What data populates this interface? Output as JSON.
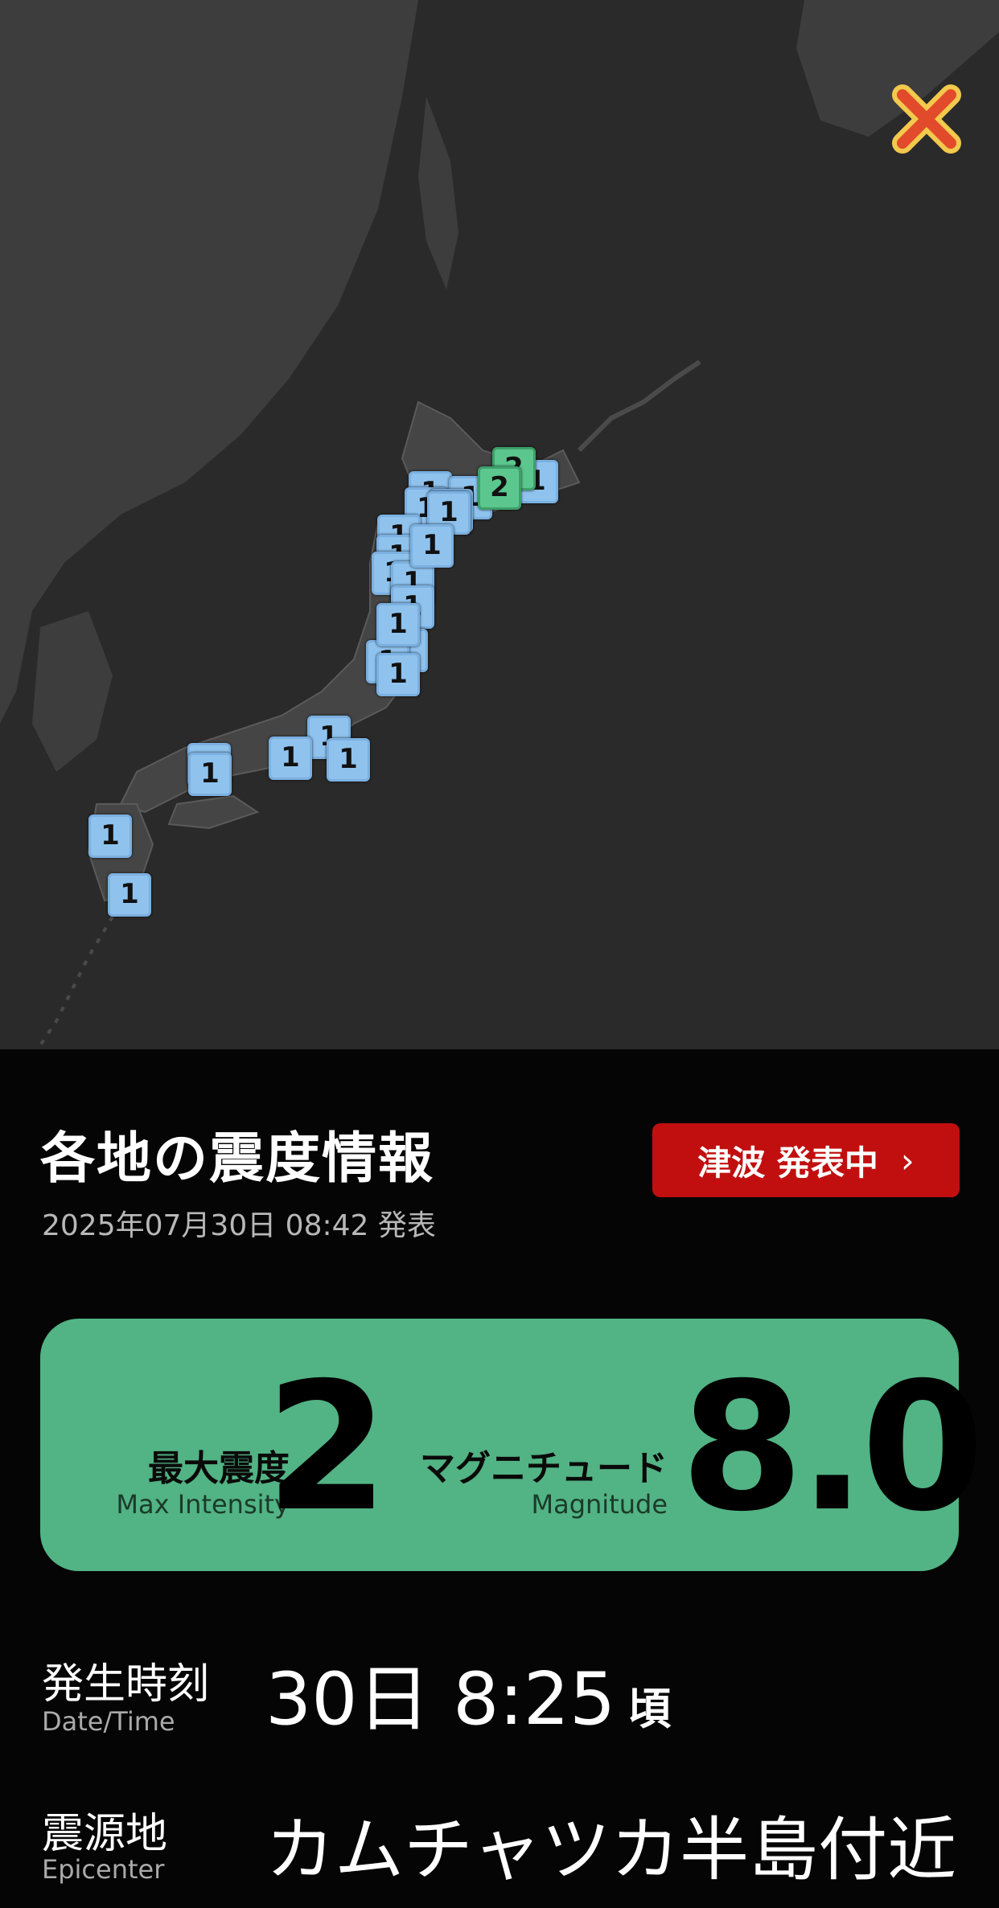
{
  "map": {
    "markers": [
      {
        "label": "1",
        "kind": "blue"
      },
      {
        "label": "1",
        "kind": "blue"
      },
      {
        "label": "1",
        "kind": "blue"
      },
      {
        "label": "1",
        "kind": "blue"
      },
      {
        "label": "1",
        "kind": "blue"
      },
      {
        "label": "1",
        "kind": "blue"
      },
      {
        "label": "1",
        "kind": "blue"
      },
      {
        "label": "1",
        "kind": "blue"
      },
      {
        "label": "1",
        "kind": "blue"
      },
      {
        "label": "1",
        "kind": "blue"
      },
      {
        "label": "1",
        "kind": "blue"
      },
      {
        "label": "1",
        "kind": "blue"
      },
      {
        "label": "1",
        "kind": "blue"
      },
      {
        "label": "1",
        "kind": "blue"
      },
      {
        "label": "1",
        "kind": "blue"
      },
      {
        "label": "1",
        "kind": "blue"
      },
      {
        "label": "1",
        "kind": "blue"
      },
      {
        "label": "1",
        "kind": "blue"
      },
      {
        "label": "1",
        "kind": "blue"
      },
      {
        "label": "1",
        "kind": "blue"
      },
      {
        "label": "1",
        "kind": "blue"
      },
      {
        "label": "1",
        "kind": "blue"
      },
      {
        "label": "1",
        "kind": "blue"
      },
      {
        "label": "2",
        "kind": "green"
      },
      {
        "label": "2",
        "kind": "green"
      }
    ]
  },
  "header": {
    "title": "各地の震度情報",
    "issued": "2025年07月30日 08:42 発表",
    "tsunami_button": "津波 発表中",
    "tsunami_chevron": "›"
  },
  "summary": {
    "max_intensity_label": "最大震度",
    "max_intensity_sub": "Max Intensity",
    "max_intensity_value": "2",
    "magnitude_label": "マグニチュード",
    "magnitude_sub": "Magnitude",
    "magnitude_value": "8.0"
  },
  "details": {
    "datetime_label": "発生時刻",
    "datetime_sub": "Date/Time",
    "datetime_value": "30日 8:25",
    "datetime_suffix": "頃",
    "epicenter_label": "震源地",
    "epicenter_sub": "Epicenter",
    "epicenter_value": "カムチャツカ半島付近"
  },
  "colors": {
    "tsunami_red": "#c10f0f",
    "summary_green": "#52b384",
    "marker_blue": "#8fc3ee",
    "marker_green": "#5bc78e"
  },
  "icons": {
    "close": "close-icon"
  }
}
